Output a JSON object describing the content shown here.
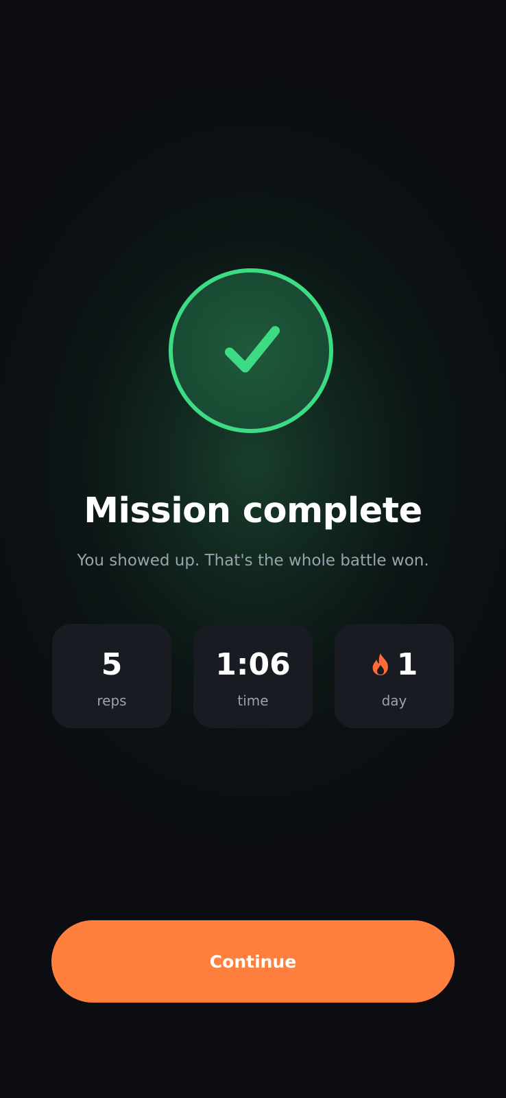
{
  "completion": {
    "icon": "checkmark-icon",
    "title": "Mission complete",
    "subtitle": "You showed up. That's the whole battle won."
  },
  "stats": [
    {
      "value": "5",
      "label": "reps",
      "icon": null
    },
    {
      "value": "1:06",
      "label": "time",
      "icon": null
    },
    {
      "value": "1",
      "label": "day",
      "icon": "flame-icon"
    }
  ],
  "actions": {
    "continue_label": "Continue"
  },
  "colors": {
    "background": "#0b0d12",
    "success_green": "#3ddc84",
    "accent_orange": "#ff7f3f",
    "card_background": "#181b22",
    "muted_text": "#9aa3ae"
  }
}
